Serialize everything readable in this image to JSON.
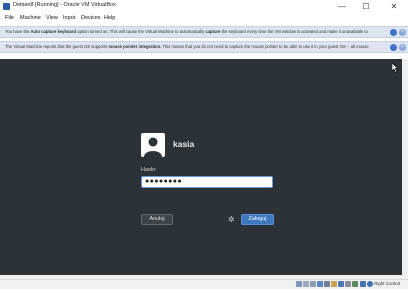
{
  "window": {
    "title": "Debian8 [Running] - Oracle VM VirtualBox",
    "minimize_glyph": "—",
    "maximize_glyph": "☐",
    "close_glyph": "✕"
  },
  "menu": {
    "items": [
      {
        "label": "File"
      },
      {
        "label": "Machine"
      },
      {
        "label": "View"
      },
      {
        "label": "Input"
      },
      {
        "label": "Devices"
      },
      {
        "label": "Help"
      }
    ]
  },
  "notifications": {
    "keyboard": {
      "prefix": "You have the ",
      "bold": "Auto capture keyboard",
      "middle": " option turned on. This will cause the Virtual Machine to automatically ",
      "bold2": "capture",
      "suffix": " the keyboard every time the VM window is activated and make it unavailable to"
    },
    "mouse": {
      "prefix": "The Virtual Machine reports that the guest OS supports ",
      "bold": "mouse pointer integration.",
      "suffix": " This means that you do not need to capture the mouse pointer to be able to use it in your guest OS -- all mouse"
    },
    "close_glyph": "×"
  },
  "login": {
    "username": "kasia",
    "password_label": "Hasło:",
    "password_value": "●●●●●●●●",
    "cancel_label": "Anuluj",
    "login_label": "Zaloguj",
    "gear_glyph": "✲"
  },
  "statusbar": {
    "host_key": "Right Control",
    "icons": [
      "hdd-icon",
      "optical-icon",
      "audio-icon",
      "network-icon",
      "usb-icon",
      "shared-folder-icon",
      "display-icon",
      "video-capture-icon",
      "cpu-icon",
      "mouse-icon"
    ]
  },
  "colors": {
    "vm_background": "#2c3338",
    "login_button": "#3f77c0",
    "notice_background": "#dde5f1"
  }
}
